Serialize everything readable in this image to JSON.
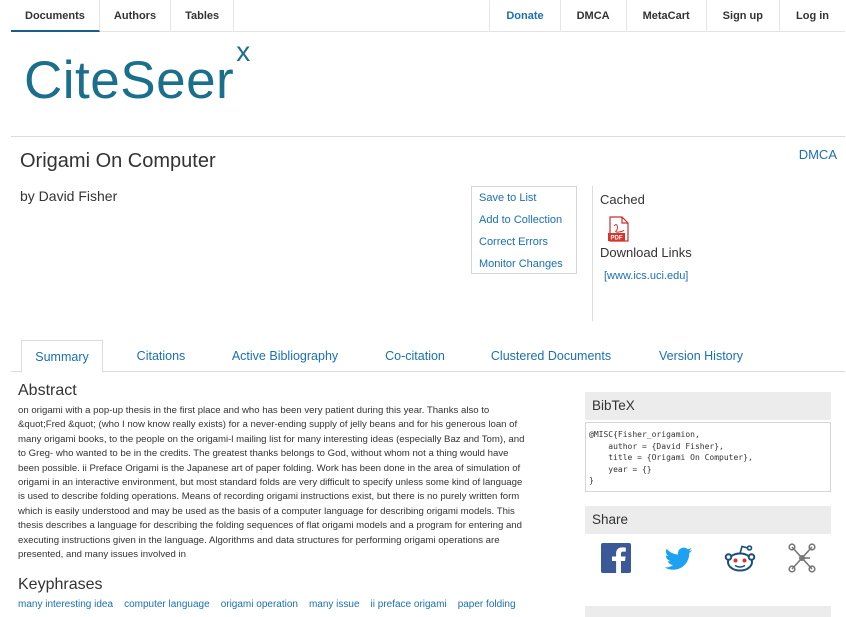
{
  "nav": {
    "left": [
      "Documents",
      "Authors",
      "Tables"
    ],
    "right": [
      "Donate",
      "DMCA",
      "MetaCart",
      "Sign up",
      "Log in"
    ]
  },
  "logo": {
    "text": "CiteSeer",
    "sup": "x"
  },
  "document": {
    "title": "Origami On Computer",
    "author": "by David Fisher",
    "dmca": "DMCA"
  },
  "actions": [
    "Save to List",
    "Add to Collection",
    "Correct Errors",
    "Monitor Changes"
  ],
  "cached": {
    "label": "Cached",
    "pdf_icon": "pdf-icon",
    "download_label": "Download Links",
    "link": "[www.ics.uci.edu]"
  },
  "tabs": [
    "Summary",
    "Citations",
    "Active Bibliography",
    "Co-citation",
    "Clustered Documents",
    "Version History"
  ],
  "abstract": {
    "heading": "Abstract",
    "lines": [
      "on origami with a pop-up thesis in the first place and who has been very patient during this year. Thanks also to",
      "&quot;Fred &quot; (who I now know really exists) for a never-ending supply of jelly beans and for his generous loan of",
      "many origami books, to the people on the origami-l mailing list for many interesting ideas (especially Baz and Tom), and",
      "to Greg- who wanted to be in the credits. The greatest thanks belongs to God, without whom not a thing would have",
      "been possible. ii Preface Origami is the Japanese art of paper folding. Work has been done in the area of simulation of",
      "origami in an interactive environment, but most standard folds are very difficult to specify unless some kind of language",
      "is used to describe folding operations. Means of recording origami instructions exist, but there is no purely written form",
      "which is easily understood and may be used as the basis of a computer language for describing origami models. This",
      "thesis describes a language for describing the folding sequences of flat origami models and a program for entering and",
      "executing instructions given in the language. Algorithms and data structures for performing origami operations are",
      "presented, and many issues involved in"
    ]
  },
  "keyphrases": {
    "heading": "Keyphrases",
    "items": [
      "many interesting idea",
      "computer language",
      "origami operation",
      "many issue",
      "ii preface origami",
      "paper folding"
    ]
  },
  "bibtex": {
    "heading": "BibTeX",
    "text": "@MISC{Fisher_origamion,\n    author = {David Fisher},\n    title = {Origami On Computer},\n    year = {}\n}"
  },
  "share": {
    "heading": "Share",
    "icons": [
      "facebook-icon",
      "twitter-icon",
      "reddit-icon",
      "network-icon"
    ],
    "colors": {
      "facebook": "#3b5998",
      "twitter": "#1da1f2",
      "reddit": "#1a4f7a",
      "network": "#777777"
    }
  }
}
